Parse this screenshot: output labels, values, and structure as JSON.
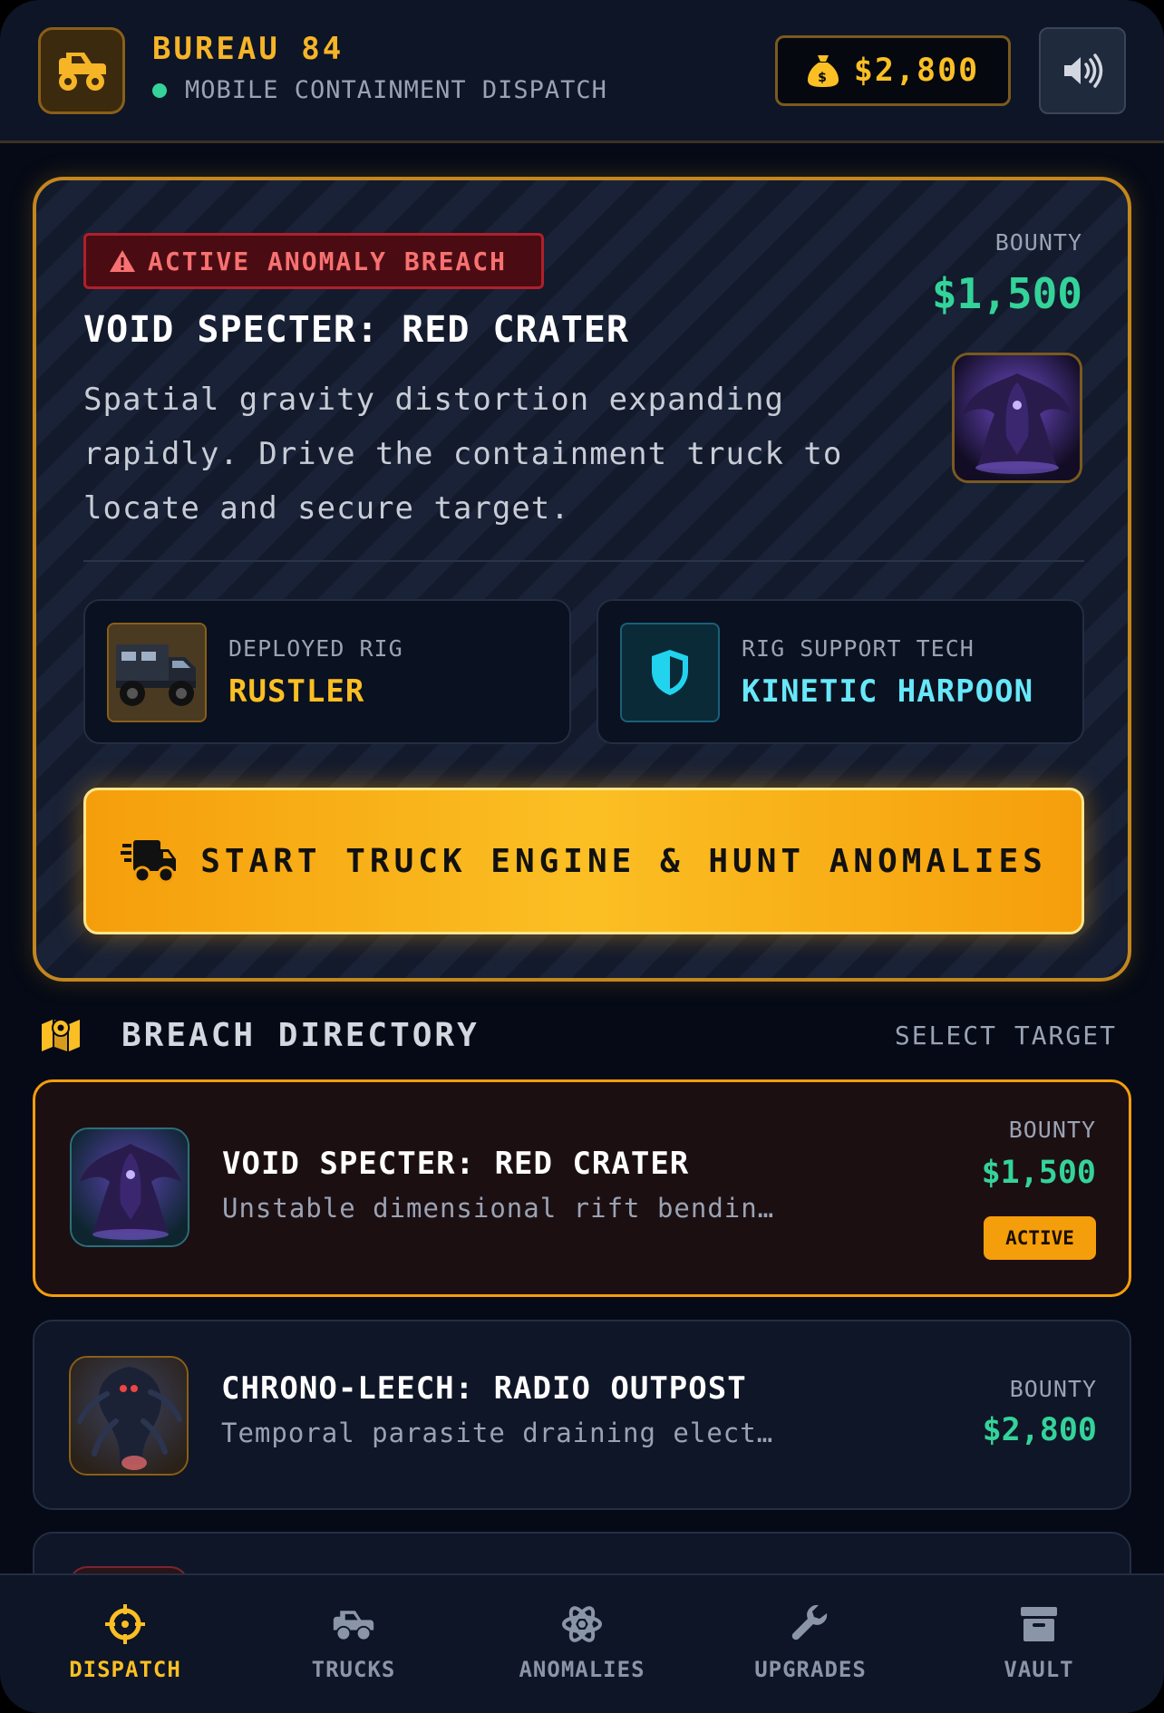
{
  "header": {
    "title": "BUREAU 84",
    "subtitle": "MOBILE CONTAINMENT DISPATCH",
    "cash": "$2,800",
    "icons": {
      "logo": "monster-truck-icon",
      "cash": "money-bag-icon",
      "sound": "speaker-icon"
    }
  },
  "active_mission": {
    "badge": "ACTIVE ANOMALY BREACH",
    "title": "VOID SPECTER: RED CRATER",
    "description": "Spatial gravity distortion expanding rapidly. Drive the containment truck to locate and secure target.",
    "bounty_label": "BOUNTY",
    "bounty": "$1,500",
    "rig": {
      "label": "DEPLOYED RIG",
      "value": "RUSTLER"
    },
    "tech": {
      "label": "RIG SUPPORT TECH",
      "value": "KINETIC HARPOON"
    },
    "start_button": "START TRUCK ENGINE & HUNT ANOMALIES"
  },
  "directory": {
    "title": "BREACH DIRECTORY",
    "action": "SELECT TARGET",
    "entries": [
      {
        "title": "VOID SPECTER: RED CRATER",
        "description": "Unstable dimensional rift bendin…",
        "bounty_label": "BOUNTY",
        "bounty": "$1,500",
        "status": "ACTIVE"
      },
      {
        "title": "CHRONO-LEECH: RADIO OUTPOST",
        "description": "Temporal parasite draining elect…",
        "bounty_label": "BOUNTY",
        "bounty": "$2,800"
      }
    ]
  },
  "nav": [
    {
      "label": "DISPATCH",
      "icon": "crosshair-icon",
      "selected": true
    },
    {
      "label": "TRUCKS",
      "icon": "truck-icon"
    },
    {
      "label": "ANOMALIES",
      "icon": "atom-icon"
    },
    {
      "label": "UPGRADES",
      "icon": "wrench-icon"
    },
    {
      "label": "VAULT",
      "icon": "archive-icon"
    }
  ],
  "colors": {
    "accent": "#f59e0b",
    "bounty_green": "#34d399",
    "danger": "#f87171",
    "tech_cyan": "#67e8f9",
    "background": "#050a16"
  }
}
